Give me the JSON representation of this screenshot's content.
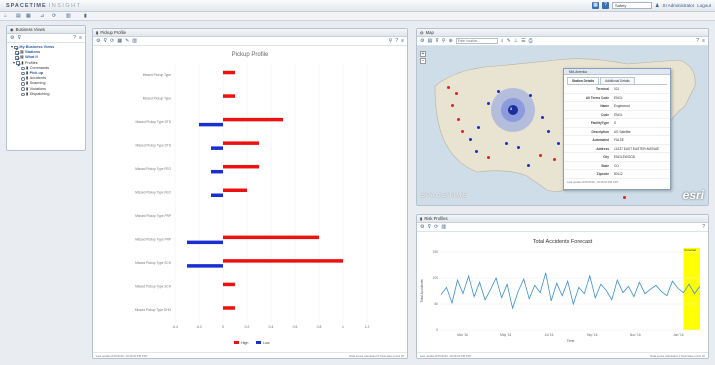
{
  "app": {
    "logo_main": "SPACETIME",
    "logo_sub": "INSIGHT",
    "context_select": "Safety",
    "user": "SI Administrator",
    "logout": "Logout"
  },
  "business_views": {
    "title": "Business Views",
    "root": "My Business Views",
    "items": [
      "Stations",
      "What If",
      "Profiles"
    ],
    "profiles": [
      "Commands",
      "Pick up",
      "Accidents",
      "Scanning",
      "Violations",
      "Dispatching"
    ],
    "selected_profile": "Pick up"
  },
  "pickup": {
    "title": "Pickup Profile",
    "footer_left": "Last update 8/15/2016, 10:35:00 PM PDT",
    "footer_right": "Data series calculated 6 Total data points 26"
  },
  "map": {
    "title": "Map",
    "search_placeholder": "Enter location...",
    "watermark": "SPACE/TIME",
    "esri": "esri",
    "cluster_count": "3",
    "popup": {
      "title": "Mid-America",
      "tab_active": "Station Details",
      "tab_other": "Additional Details",
      "rows": [
        {
          "k": "Terminal",
          "v": "021"
        },
        {
          "k": "All Terms Code",
          "v": "ENGL"
        },
        {
          "k": "Name",
          "v": "Englewood"
        },
        {
          "k": "Code",
          "v": "ENGL"
        },
        {
          "k": "FacilityType",
          "v": "S"
        },
        {
          "k": "Description",
          "v": "US Satellite"
        },
        {
          "k": "Automated",
          "v": "FALSE"
        },
        {
          "k": "Address",
          "v": "14237 EAST EASTER AVENUE"
        },
        {
          "k": "City",
          "v": "ENGLEWOOD"
        },
        {
          "k": "State",
          "v": "CO"
        },
        {
          "k": "Zipcode",
          "v": "80112"
        }
      ],
      "footer": "Last update 8/15/2016, 10:35:00 PM PDT"
    }
  },
  "risk": {
    "title": "Risk Profiles",
    "footer_left": "Last update 8/15/2016, 10:35:00 PM PDT",
    "footer_right": "Data series calculated 1 Total data points 26",
    "forecast_label": "Forecast"
  },
  "chart_data": [
    {
      "type": "bar",
      "orientation": "horizontal",
      "title": "Pickup Profile",
      "categories": [
        "Missed Pickup Type",
        "Missed Pickup Type",
        "Missed Pickup Type DTS",
        "Missed Pickup Type DTS",
        "Missed Pickup Type FEO",
        "Missed Pickup Type FEO",
        "Missed Pickup Type PRP",
        "Missed Pickup Type PRP",
        "Missed Pickup Type SCH",
        "Missed Pickup Type SCH",
        "Missed Pickup Type SHO"
      ],
      "series": [
        {
          "name": "High",
          "color": "#ee1111",
          "values": [
            0.1,
            0.1,
            0.5,
            0.3,
            0.3,
            0.2,
            0,
            0.8,
            1.0,
            0.1,
            0.1
          ]
        },
        {
          "name": "Low",
          "color": "#1a2fd0",
          "values": [
            0,
            0,
            -0.2,
            -0.1,
            -0.1,
            -0.1,
            0,
            -0.3,
            -0.3,
            0,
            0
          ]
        }
      ],
      "xlim": [
        -0.4,
        1.2
      ],
      "xticks": [
        "-0.4",
        "-0.2",
        "0",
        "0.2",
        "0.4",
        "0.6",
        "0.8",
        "1",
        "1.2"
      ],
      "legend": "bottom"
    },
    {
      "type": "line",
      "title": "Total Accidents Forecast",
      "xlabel": "Time",
      "ylabel": "Total Accidents",
      "ylim": [
        0,
        150
      ],
      "yticks": [
        "0",
        "50",
        "100",
        "150"
      ],
      "x_ticks": [
        "Mar '16",
        "May '16",
        "Jul '16",
        "Sep '16",
        "Nov '16",
        "Jan '16"
      ],
      "series": [
        {
          "color": "#3a8fd6",
          "values": [
            68,
            82,
            52,
            96,
            70,
            104,
            64,
            92,
            58,
            78,
            100,
            62,
            88,
            42,
            74,
            98,
            60,
            86,
            72,
            110,
            56,
            90,
            66,
            94,
            50,
            82,
            70,
            104,
            62,
            88,
            76,
            58,
            96,
            72,
            84,
            64,
            92,
            70,
            78,
            86,
            74,
            66,
            94,
            80,
            72,
            88,
            70,
            84
          ]
        }
      ],
      "forecast_start_index": 44,
      "legend": "none"
    }
  ]
}
